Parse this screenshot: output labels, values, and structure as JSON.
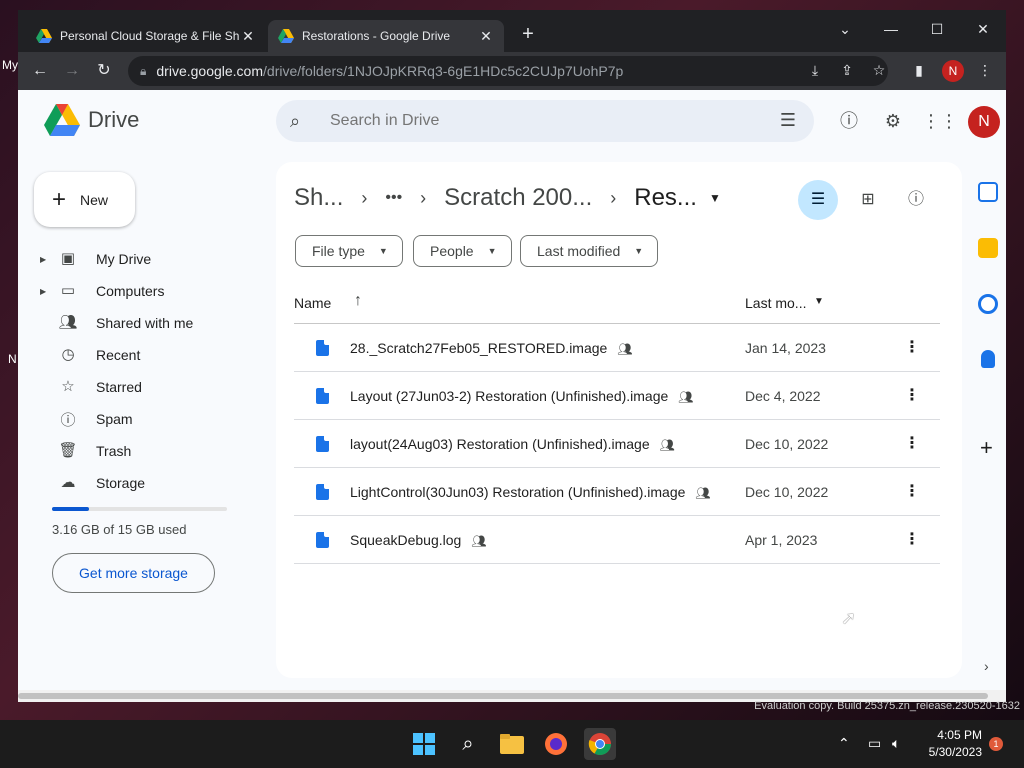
{
  "desktop": {
    "labels": [
      "My",
      "N"
    ]
  },
  "browser": {
    "tabs": [
      {
        "title": "Personal Cloud Storage & File Sh",
        "close": "✕"
      },
      {
        "title": "Restorations - Google Drive",
        "close": "✕"
      }
    ],
    "new_tab": "+",
    "window_controls": {
      "dropdown": "⌄",
      "minimize": "—",
      "maximize": "☐",
      "close": "✕"
    },
    "url_host": "drive.google.com",
    "url_path": "/drive/folders/1NJOJpKRRq3-6gE1HDc5c2CUJp7UohP7p",
    "profile_initial": "N"
  },
  "drive": {
    "app_name": "Drive",
    "search_placeholder": "Search in Drive",
    "account_initial": "N",
    "new_label": "New",
    "sidebar": [
      {
        "label": "My Drive",
        "icon": "my-drive-icon",
        "caret": true
      },
      {
        "label": "Computers",
        "icon": "computers-icon",
        "caret": true
      },
      {
        "label": "Shared with me",
        "icon": "shared-icon",
        "caret": false
      },
      {
        "label": "Recent",
        "icon": "clock-icon",
        "caret": false
      },
      {
        "label": "Starred",
        "icon": "star-icon",
        "caret": false
      },
      {
        "label": "Spam",
        "icon": "spam-icon",
        "caret": false
      },
      {
        "label": "Trash",
        "icon": "trash-icon",
        "caret": false
      },
      {
        "label": "Storage",
        "icon": "cloud-icon",
        "caret": false
      }
    ],
    "storage": {
      "used_text": "3.16 GB of 15 GB used",
      "fraction": 0.21
    },
    "get_storage_label": "Get more storage",
    "breadcrumb": {
      "first": "Sh...",
      "ellipsis": "•••",
      "middle": "Scratch 200...",
      "current": "Res..."
    },
    "filters": [
      "File type",
      "People",
      "Last modified"
    ],
    "columns": {
      "name": "Name",
      "modified": "Last mo..."
    },
    "files": [
      {
        "name": "28._Scratch27Feb05_RESTORED.image",
        "date": "Jan 14, 2023"
      },
      {
        "name": "Layout (27Jun03-2) Restoration (Unfinished).image",
        "date": "Dec 4, 2022"
      },
      {
        "name": "layout(24Aug03) Restoration (Unfinished).image",
        "date": "Dec 10, 2022"
      },
      {
        "name": "LightControl(30Jun03) Restoration (Unfinished).image",
        "date": "Dec 10, 2022"
      },
      {
        "name": "SqueakDebug.log",
        "date": "Apr 1, 2023"
      }
    ]
  },
  "watermark": "Evaluation copy. Build 25375.zn_release.230520-1632",
  "taskbar": {
    "time": "4:05 PM",
    "date": "5/30/2023",
    "notification_count": "1"
  },
  "colors": {
    "accent": "#0b57d0",
    "filter_active": "#c2e7ff",
    "avatar": "#c5221f"
  }
}
